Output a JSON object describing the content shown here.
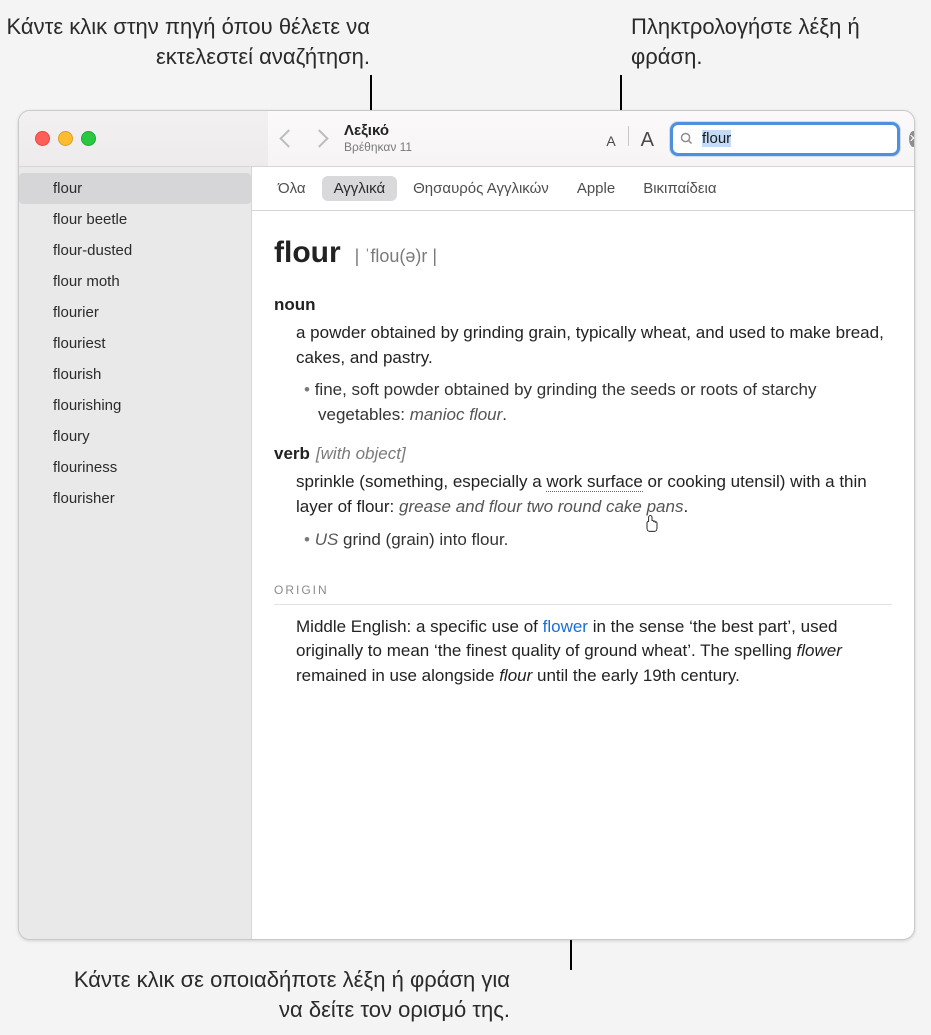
{
  "callouts": {
    "top_left": "Κάντε κλικ στην πηγή όπου θέλετε να εκτελεστεί αναζήτηση.",
    "top_right": "Πληκτρολογήστε λέξη ή φράση.",
    "bottom": "Κάντε κλικ σε οποιαδήποτε λέξη ή φράση για να δείτε τον ορισμό της."
  },
  "window": {
    "title": "Λεξικό",
    "subtitle": "Βρέθηκαν 11"
  },
  "toolbar": {
    "font_small": "A",
    "font_large": "A",
    "search_value": "flour",
    "clear_glyph": "✕"
  },
  "sources": {
    "items": [
      {
        "label": "Όλα",
        "active": false
      },
      {
        "label": "Αγγλικά",
        "active": true
      },
      {
        "label": "Θησαυρός Αγγλικών",
        "active": false
      },
      {
        "label": "Apple",
        "active": false
      },
      {
        "label": "Βικιπαίδεια",
        "active": false
      }
    ]
  },
  "sidebar": {
    "items": [
      {
        "label": "flour",
        "selected": true
      },
      {
        "label": "flour beetle"
      },
      {
        "label": "flour-dusted"
      },
      {
        "label": "flour moth"
      },
      {
        "label": "flourier"
      },
      {
        "label": "flouriest"
      },
      {
        "label": "flourish"
      },
      {
        "label": "flourishing"
      },
      {
        "label": "floury"
      },
      {
        "label": "flouriness"
      },
      {
        "label": "flourisher"
      }
    ]
  },
  "entry": {
    "headword": "flour",
    "pronunciation": "| ˈflou(ə)r |",
    "noun": {
      "pos": "noun",
      "def": "a powder obtained by grinding grain, typically wheat, and used to make bread, cakes, and pastry.",
      "sub_prefix": "fine, soft powder obtained by grinding the seeds or roots of starchy vegetables: ",
      "sub_example": "manioc flour"
    },
    "verb": {
      "pos": "verb",
      "grammar": "[with object]",
      "def_pre": "sprinkle (something, especially a ",
      "def_term": "work surface",
      "def_post": " or cooking utensil) with a thin layer of flour: ",
      "def_example": "grease and flour two round cake pans",
      "sub_region": "US",
      "sub_text": " grind (grain) into flour."
    },
    "origin": {
      "heading": "ORIGIN",
      "pre": "Middle English: a specific use of ",
      "link": "flower",
      "mid": " in the sense ‘the best part’, used originally to mean ‘the finest quality of ground wheat’. The spelling ",
      "em1": "flower",
      "mid2": " remained in use alongside ",
      "em2": "flour",
      "post": " until the early 19th century."
    }
  }
}
